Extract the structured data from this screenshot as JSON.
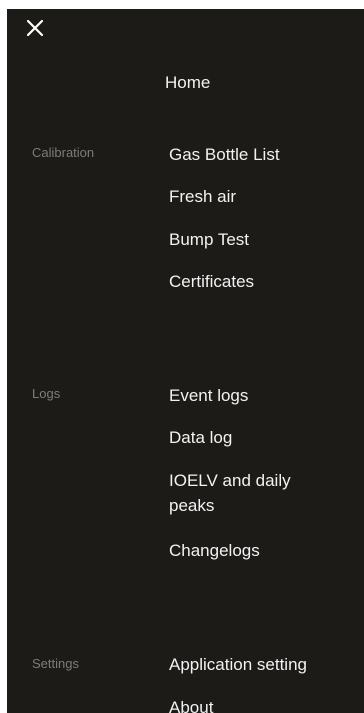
{
  "menu": {
    "home": "Home",
    "sections": {
      "calibration": {
        "label": "Calibration",
        "items": [
          "Gas Bottle List",
          "Fresh air",
          "Bump Test",
          "Certificates"
        ]
      },
      "logs": {
        "label": "Logs",
        "items": [
          "Event logs",
          "Data log",
          "IOELV and daily peaks",
          "Changelogs"
        ]
      },
      "settings": {
        "label": "Settings",
        "items": [
          "Application setting",
          "About"
        ]
      }
    }
  },
  "icons": {
    "close": "close-icon"
  },
  "colors": {
    "panel_background": "#1c1b18",
    "item_text": "#f2f2f2",
    "section_label_text": "#7c7c78"
  }
}
